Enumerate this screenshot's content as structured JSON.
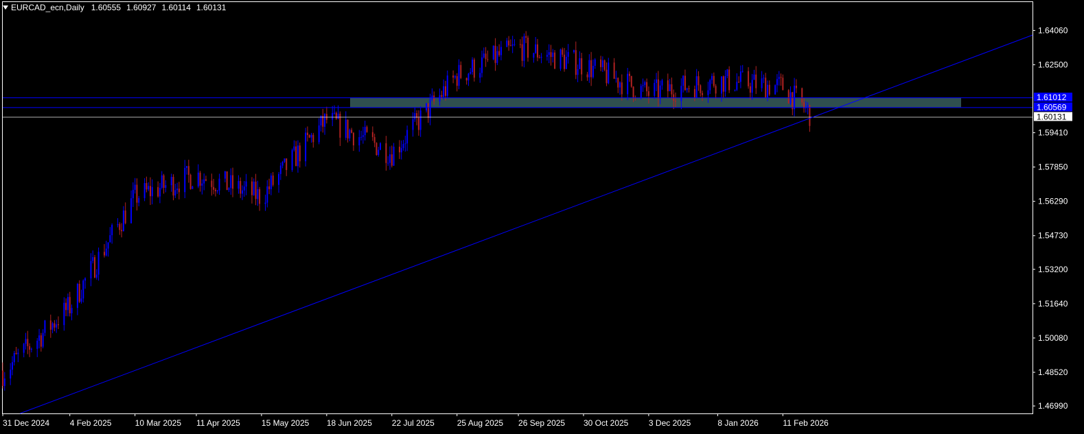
{
  "header": {
    "symbol": "EURCAD_ecn,Daily",
    "open": "1.60555",
    "high": "1.60927",
    "low": "1.60114",
    "close": "1.60131"
  },
  "colors": {
    "background": "#000000",
    "frame": "#ffffff",
    "bull": "#0000ff",
    "bear": "#b22222",
    "trendline": "#0000ff",
    "zone": "#2f4f4f",
    "price_line": "#ffffff"
  },
  "chart_data": {
    "type": "candlestick",
    "symbol": "EURCAD_ecn",
    "timeframe": "Daily",
    "ylim": [
      1.4665,
      1.6535
    ],
    "y_ticks": [
      "1.64060",
      "1.62500",
      "1.59410",
      "1.57850",
      "1.56290",
      "1.54730",
      "1.53200",
      "1.51640",
      "1.50080",
      "1.48520",
      "1.46990"
    ],
    "x_ticks": [
      "31 Dec 2024",
      "4 Feb 2025",
      "10 Mar 2025",
      "11 Apr 2025",
      "15 May 2025",
      "18 Jun 2025",
      "22 Jul 2025",
      "25 Aug 2025",
      "26 Sep 2025",
      "30 Oct 2025",
      "3 Dec 2025",
      "8 Jan 2026",
      "11 Feb 2026"
    ],
    "horizontal_lines": [
      {
        "label": "1.61012",
        "value": 1.61012,
        "color": "#0000ff"
      },
      {
        "label": "1.60569",
        "value": 1.60569,
        "color": "#0000ff"
      }
    ],
    "current_price": {
      "label": "1.60131",
      "value": 1.60131
    },
    "zone": {
      "from": 1.60569,
      "to": 1.61012,
      "color": "#2f4f4f"
    },
    "trendline": {
      "from_date": "2025-01-09",
      "from_price": 1.4665,
      "to_date": "2026-02-27",
      "to_price": 1.6013
    },
    "series": {
      "dates": [
        "2024-12-31",
        "2025-02-04",
        "2025-03-10",
        "2025-04-11",
        "2025-05-15",
        "2025-06-18",
        "2025-07-22",
        "2025-08-25",
        "2025-09-26",
        "2025-10-30",
        "2025-12-03",
        "2026-01-08",
        "2026-02-11",
        "2026-02-27"
      ],
      "approx_close": [
        1.485,
        1.515,
        1.565,
        1.575,
        1.565,
        1.6,
        1.585,
        1.62,
        1.633,
        1.625,
        1.612,
        1.618,
        1.615,
        1.6013
      ]
    }
  }
}
